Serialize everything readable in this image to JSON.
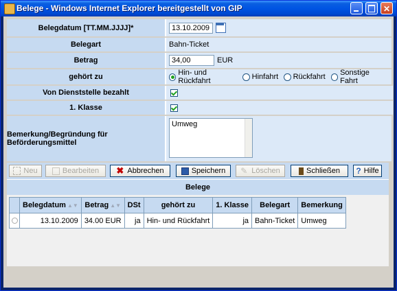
{
  "window": {
    "title": "Belege - Windows Internet Explorer bereitgestellt von GIP"
  },
  "form": {
    "belegdatum_label": "Belegdatum [TT.MM.JJJJ]*",
    "belegdatum_value": "13.10.2009",
    "belegart_label": "Belegart",
    "belegart_value": "Bahn-Ticket",
    "betrag_label": "Betrag",
    "betrag_value": "34,00",
    "betrag_unit": "EUR",
    "gehoert_label": "gehört zu",
    "gehoert_options": [
      "Hin- und Rückfahrt",
      "Hinfahrt",
      "Rückfahrt",
      "Sonstige Fahrt"
    ],
    "gehoert_selected": "Hin- und Rückfahrt",
    "dienststelle_label": "Von Dienststelle bezahlt",
    "dienststelle_checked": true,
    "klasse_label": "1. Klasse",
    "klasse_checked": true,
    "bemerkung_label": "Bemerkung/Begründung für Beförderungsmittel",
    "bemerkung_value": "Umweg"
  },
  "toolbar": {
    "neu": "Neu",
    "bearbeiten": "Bearbeiten",
    "abbrechen": "Abbrechen",
    "speichern": "Speichern",
    "loeschen": "Löschen",
    "schliessen": "Schließen",
    "hilfe": "Hilfe"
  },
  "belege": {
    "title": "Belege",
    "columns": [
      "Belegdatum",
      "Betrag",
      "DSt",
      "gehört zu",
      "1. Klasse",
      "Belegart",
      "Bemerkung"
    ],
    "rows": [
      [
        "13.10.2009",
        "34.00 EUR",
        "ja",
        "Hin- und Rückfahrt",
        "ja",
        "Bahn-Ticket",
        "Umweg"
      ]
    ]
  },
  "colors": {
    "title_bar": "#0054e3",
    "row_light": "#dce9f8",
    "row_dark": "#c6daf1",
    "border": "#7f9db9"
  }
}
